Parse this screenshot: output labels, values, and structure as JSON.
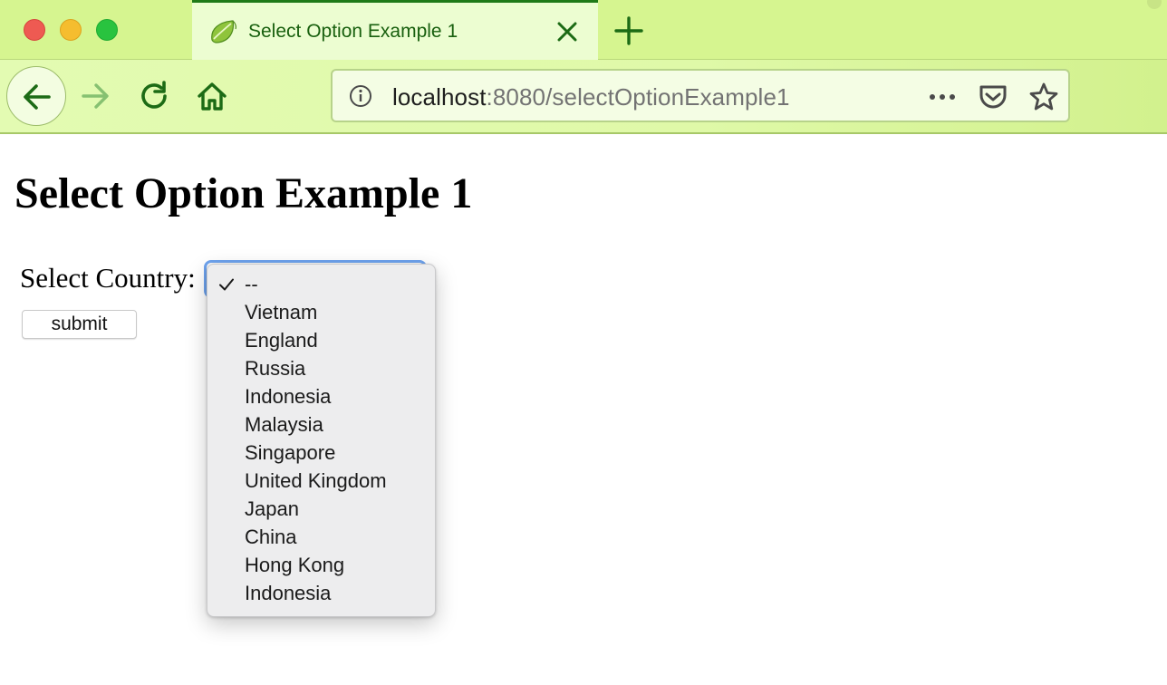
{
  "browser": {
    "tab": {
      "title": "Select Option Example 1",
      "favicon": "spring-leaf-icon",
      "close_icon": "close-icon"
    },
    "new_tab_icon": "plus-icon",
    "toolbar": {
      "back_icon": "arrow-left-icon",
      "forward_icon": "arrow-right-icon",
      "reload_icon": "reload-icon",
      "home_icon": "home-icon"
    },
    "urlbar": {
      "info_icon": "info-icon",
      "host": "localhost",
      "rest": ":8080/selectOptionExample1",
      "actions": [
        "more-icon",
        "pocket-icon",
        "star-icon"
      ]
    },
    "colors": {
      "theme": "#d6f590",
      "accent": "#1f7a18"
    }
  },
  "page": {
    "heading": "Select Option Example 1",
    "form": {
      "country_label": "Select Country:",
      "submit_label": "submit",
      "selected_value": "--",
      "options": [
        "--",
        "Vietnam",
        "England",
        "Russia",
        "Indonesia",
        "Malaysia",
        "Singapore",
        "United Kingdom",
        "Japan",
        "China",
        "Hong Kong",
        "Indonesia"
      ]
    }
  }
}
